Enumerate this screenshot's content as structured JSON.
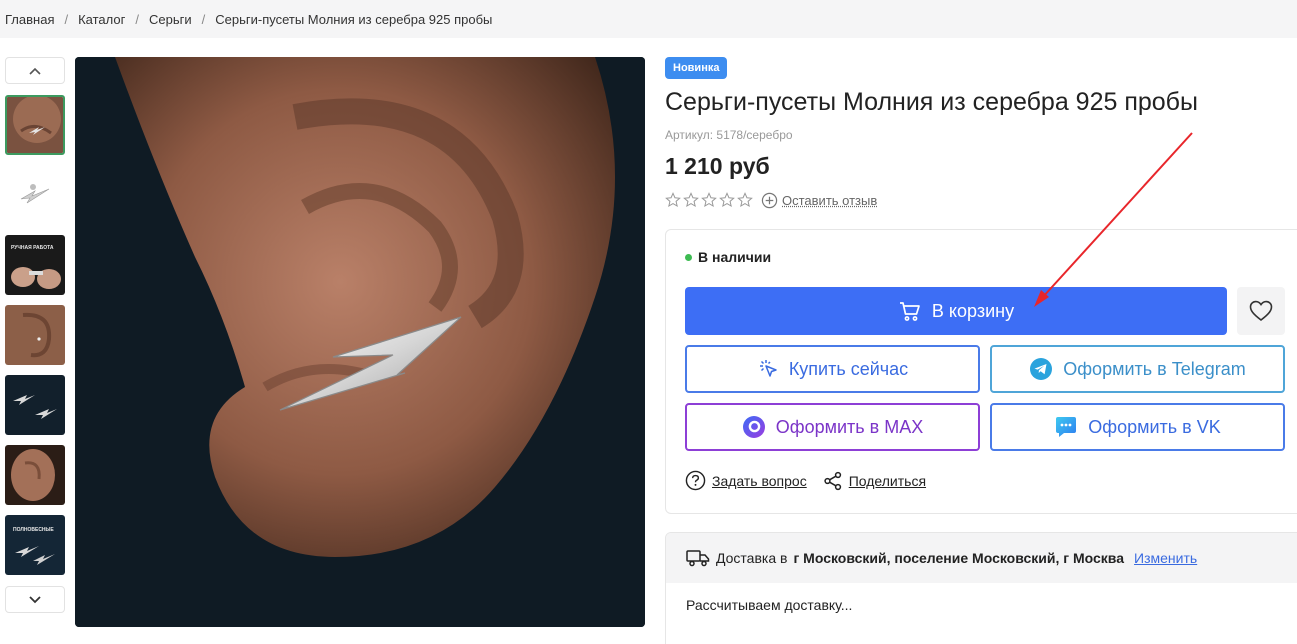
{
  "breadcrumb": {
    "items": [
      "Главная",
      "Каталог",
      "Серьги",
      "Серьги-пусеты Молния из серебра 925 пробы"
    ],
    "separator": "/"
  },
  "gallery": {
    "thumb_count": 7,
    "active_index": 0,
    "thumbs": [
      {
        "caption": ""
      },
      {
        "caption": ""
      },
      {
        "caption": "РУЧНАЯ РАБОТА"
      },
      {
        "caption": ""
      },
      {
        "caption": ""
      },
      {
        "caption": ""
      },
      {
        "caption": "ПОЛНОВЕСНЫЕ"
      }
    ]
  },
  "product": {
    "badge": "Новинка",
    "title": "Серьги-пусеты Молния из серебра 925 пробы",
    "article": "Артикул: 5178/серебро",
    "price": "1 210 руб",
    "rating": 0,
    "review_link": "Оставить отзыв"
  },
  "buy": {
    "stock": "В наличии",
    "cart_label": "В корзину",
    "buy_now_label": "Купить сейчас",
    "telegram_label": "Оформить в Telegram",
    "max_label": "Оформить в MAX",
    "vk_label": "Оформить в VK",
    "ask_label": "Задать вопрос",
    "share_label": "Поделиться"
  },
  "delivery": {
    "prefix": "Доставка в",
    "location": "г Московский, поселение Московский, г Москва",
    "change_label": "Изменить",
    "status": "Рассчитываем доставку..."
  },
  "colors": {
    "primary": "#3d6ef5",
    "badge": "#3d8df0",
    "stock_dot": "#3dbb52",
    "max_purple": "#8d3fd6",
    "telegram": "#4fa5d8",
    "annotation_arrow": "#e8262b"
  }
}
